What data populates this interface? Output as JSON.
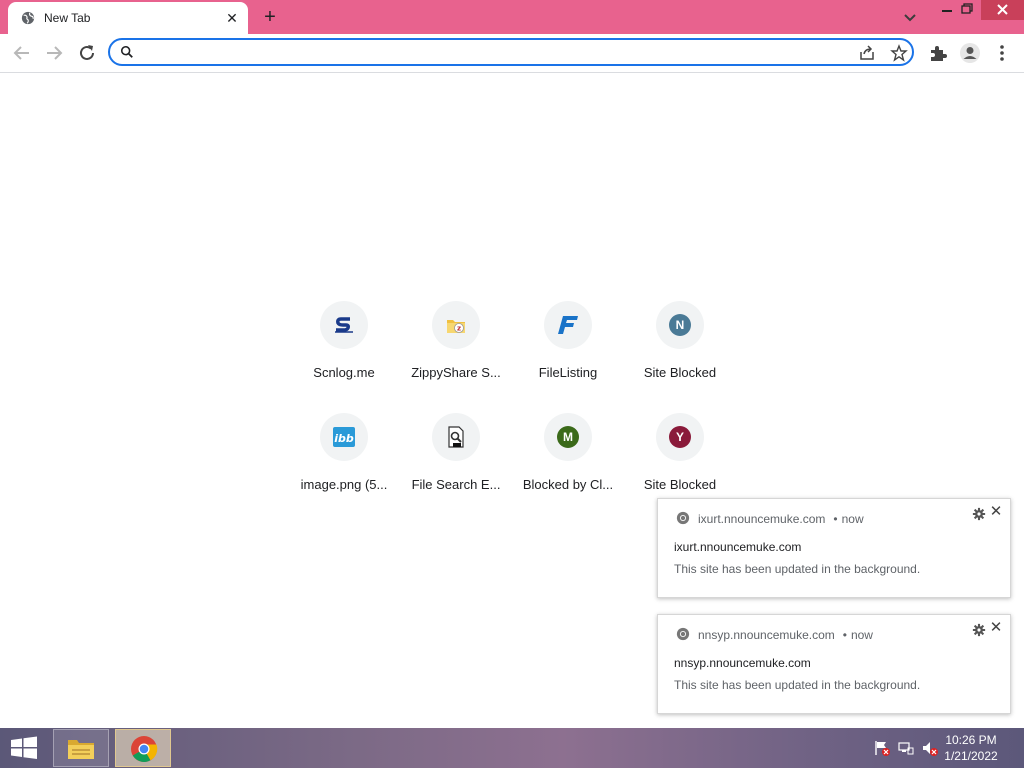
{
  "browser": {
    "tab": {
      "title": "New Tab"
    },
    "omnibox": {
      "value": "",
      "placeholder": ""
    }
  },
  "shortcuts": [
    {
      "label": "Scnlog.me",
      "icon": "scnlog-s-icon",
      "color": "#1a3a8a"
    },
    {
      "label": "ZippyShare S...",
      "icon": "zippyshare-icon",
      "color": "#f0c040"
    },
    {
      "label": "FileListing",
      "icon": "filelisting-f-icon",
      "color": "#1a73c8"
    },
    {
      "label": "Site Blocked",
      "letter": "N",
      "color": "#4a7a96"
    },
    {
      "label": "image.png (5...",
      "icon": "ibb-icon",
      "color": "#2a9ad8"
    },
    {
      "label": "File Search E...",
      "icon": "file-search-icon",
      "color": "#333333"
    },
    {
      "label": "Blocked by Cl...",
      "letter": "M",
      "color": "#3b6a1a"
    },
    {
      "label": "Site Blocked",
      "letter": "Y",
      "color": "#8a1a3a"
    }
  ],
  "notifications": [
    {
      "source": "ixurt.nnouncemuke.com",
      "time": "now",
      "title": "ixurt.nnouncemuke.com",
      "body": "This site has been updated in the background."
    },
    {
      "source": "nnsyp.nnouncemuke.com",
      "time": "now",
      "title": "nnsyp.nnouncemuke.com",
      "body": "This site has been updated in the background."
    }
  ],
  "taskbar": {
    "time": "10:26 PM",
    "date": "1/21/2022"
  },
  "colors": {
    "tabstrip": "#e8628e",
    "omnibox_border": "#1a73e8",
    "window_close": "#c9405a"
  }
}
